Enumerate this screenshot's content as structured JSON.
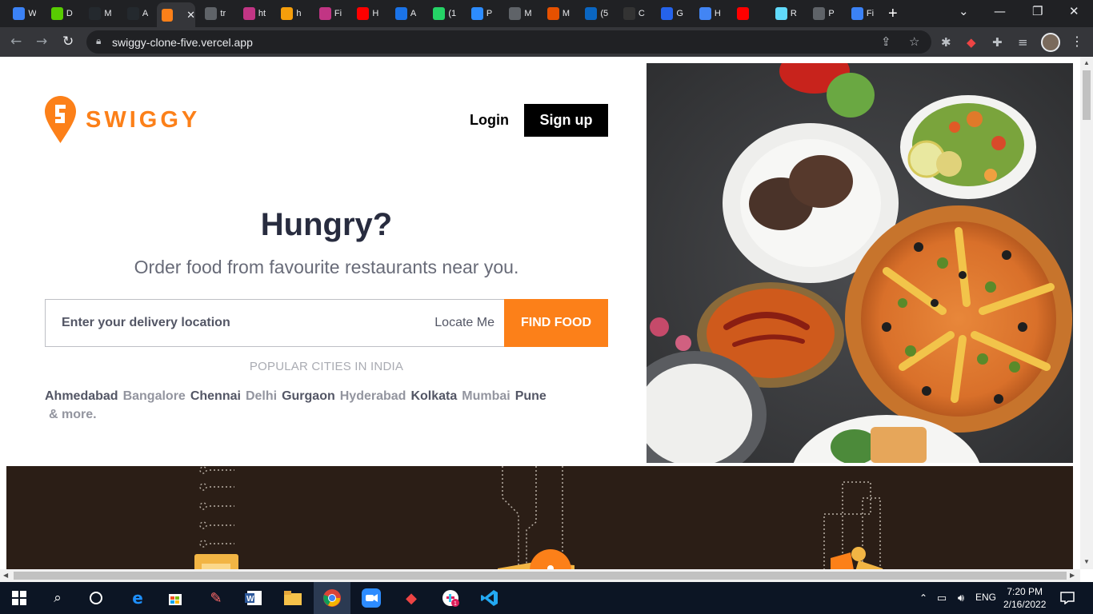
{
  "browser": {
    "tabs": [
      {
        "title": "W",
        "favicon": "spark-icon",
        "color": "#3b82f6"
      },
      {
        "title": "D",
        "favicon": "duolingo-icon",
        "color": "#58cc02"
      },
      {
        "title": "M",
        "favicon": "github-icon",
        "color": "#24292e"
      },
      {
        "title": "A",
        "favicon": "github-icon",
        "color": "#24292e"
      },
      {
        "title": "",
        "favicon": "swiggy-icon",
        "color": "#fc8019",
        "active": true
      },
      {
        "title": "tr",
        "favicon": "globe-icon",
        "color": "#5f6368"
      },
      {
        "title": "ht",
        "favicon": "instagram-icon",
        "color": "#c13584"
      },
      {
        "title": "h",
        "favicon": "noodles-icon",
        "color": "#f59e0b"
      },
      {
        "title": "Fi",
        "favicon": "instagram-icon",
        "color": "#c13584"
      },
      {
        "title": "H",
        "favicon": "youtube-icon",
        "color": "#ff0000"
      },
      {
        "title": "A",
        "favicon": "minus-icon",
        "color": "#1a73e8"
      },
      {
        "title": "(1",
        "favicon": "whatsapp-icon",
        "color": "#25d366"
      },
      {
        "title": "P",
        "favicon": "zoom-icon",
        "color": "#2d8cff"
      },
      {
        "title": "M",
        "favicon": "globe-icon",
        "color": "#5f6368"
      },
      {
        "title": "M",
        "favicon": "fox-icon",
        "color": "#e65100"
      },
      {
        "title": "(5",
        "favicon": "linkedin-icon",
        "color": "#0a66c2"
      },
      {
        "title": "C",
        "favicon": "s-icon",
        "color": "#333333"
      },
      {
        "title": "G",
        "favicon": "c-icon",
        "color": "#2563eb"
      },
      {
        "title": "H",
        "favicon": "docs-icon",
        "color": "#4285f4"
      },
      {
        "title": "",
        "favicon": "youtube-icon",
        "color": "#ff0000"
      },
      {
        "title": "R",
        "favicon": "react-icon",
        "color": "#61dafb"
      },
      {
        "title": "P",
        "favicon": "globe-icon",
        "color": "#5f6368"
      },
      {
        "title": "Fi",
        "favicon": "flag-icon",
        "color": "#3b82f6"
      }
    ],
    "url": "swiggy-clone-five.vercel.app"
  },
  "header": {
    "logo_text": "SWIGGY",
    "login_label": "Login",
    "signup_label": "Sign up"
  },
  "hero": {
    "title": "Hungry?",
    "subtitle": "Order food from favourite restaurants near you."
  },
  "search": {
    "placeholder": "Enter your delivery location",
    "locate_label": "Locate Me",
    "find_label": "FIND FOOD"
  },
  "cities": {
    "heading": "POPULAR CITIES IN INDIA",
    "list": [
      {
        "name": "Ahmedabad",
        "tone": "dark"
      },
      {
        "name": "Bangalore",
        "tone": "light"
      },
      {
        "name": "Chennai",
        "tone": "dark"
      },
      {
        "name": "Delhi",
        "tone": "light"
      },
      {
        "name": "Gurgaon",
        "tone": "dark"
      },
      {
        "name": "Hyderabad",
        "tone": "light"
      },
      {
        "name": "Kolkata",
        "tone": "dark"
      },
      {
        "name": "Mumbai",
        "tone": "light"
      },
      {
        "name": "Pune",
        "tone": "dark"
      }
    ],
    "more_label": "& more."
  },
  "colors": {
    "brand": "#fc8019",
    "title": "#282c3f",
    "dark_band": "#2b1e16"
  },
  "taskbar": {
    "lang": "ENG",
    "time": "7:20 PM",
    "date": "2/16/2022"
  }
}
